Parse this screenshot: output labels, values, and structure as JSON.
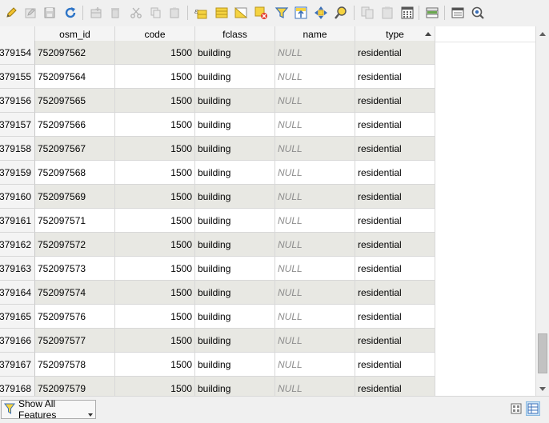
{
  "toolbar": {
    "icons": [
      "pencil-icon",
      "multi-edit-icon",
      "save-icon",
      "reload-icon",
      "add-feature-icon",
      "delete-icon",
      "cut-icon",
      "copy-icon",
      "paste-icon",
      "expression-select-icon",
      "select-all-icon",
      "invert-selection-icon",
      "deselect-icon",
      "filter-icon",
      "move-top-icon",
      "pan-icon",
      "zoom-icon",
      "copy-cells-icon",
      "paste-cells-icon",
      "field-calculator-icon",
      "conditional-format-icon",
      "form-view-icon",
      "actions-icon"
    ]
  },
  "table": {
    "columns": [
      {
        "key": "row_num",
        "label": ""
      },
      {
        "key": "osm_id",
        "label": "osm_id"
      },
      {
        "key": "code",
        "label": "code"
      },
      {
        "key": "fclass",
        "label": "fclass"
      },
      {
        "key": "name",
        "label": "name"
      },
      {
        "key": "type",
        "label": "type"
      }
    ],
    "rows": [
      {
        "row_num": "379154",
        "osm_id": "752097562",
        "code": "1500",
        "fclass": "building",
        "name": "NULL",
        "type": "residential"
      },
      {
        "row_num": "379155",
        "osm_id": "752097564",
        "code": "1500",
        "fclass": "building",
        "name": "NULL",
        "type": "residential"
      },
      {
        "row_num": "379156",
        "osm_id": "752097565",
        "code": "1500",
        "fclass": "building",
        "name": "NULL",
        "type": "residential"
      },
      {
        "row_num": "379157",
        "osm_id": "752097566",
        "code": "1500",
        "fclass": "building",
        "name": "NULL",
        "type": "residential"
      },
      {
        "row_num": "379158",
        "osm_id": "752097567",
        "code": "1500",
        "fclass": "building",
        "name": "NULL",
        "type": "residential"
      },
      {
        "row_num": "379159",
        "osm_id": "752097568",
        "code": "1500",
        "fclass": "building",
        "name": "NULL",
        "type": "residential"
      },
      {
        "row_num": "379160",
        "osm_id": "752097569",
        "code": "1500",
        "fclass": "building",
        "name": "NULL",
        "type": "residential"
      },
      {
        "row_num": "379161",
        "osm_id": "752097571",
        "code": "1500",
        "fclass": "building",
        "name": "NULL",
        "type": "residential"
      },
      {
        "row_num": "379162",
        "osm_id": "752097572",
        "code": "1500",
        "fclass": "building",
        "name": "NULL",
        "type": "residential"
      },
      {
        "row_num": "379163",
        "osm_id": "752097573",
        "code": "1500",
        "fclass": "building",
        "name": "NULL",
        "type": "residential"
      },
      {
        "row_num": "379164",
        "osm_id": "752097574",
        "code": "1500",
        "fclass": "building",
        "name": "NULL",
        "type": "residential"
      },
      {
        "row_num": "379165",
        "osm_id": "752097576",
        "code": "1500",
        "fclass": "building",
        "name": "NULL",
        "type": "residential"
      },
      {
        "row_num": "379166",
        "osm_id": "752097577",
        "code": "1500",
        "fclass": "building",
        "name": "NULL",
        "type": "residential"
      },
      {
        "row_num": "379167",
        "osm_id": "752097578",
        "code": "1500",
        "fclass": "building",
        "name": "NULL",
        "type": "residential"
      },
      {
        "row_num": "379168",
        "osm_id": "752097579",
        "code": "1500",
        "fclass": "building",
        "name": "NULL",
        "type": "residential"
      }
    ],
    "sorted_column": "type",
    "sort_order": "ascending"
  },
  "scrollbar": {
    "position_fraction": 0.97
  },
  "statusbar": {
    "filter_label": "Show All Features"
  },
  "colors": {
    "alt_row": "#e8e8e3",
    "null_text": "#8c8c8c",
    "accent": "#3a78c8"
  }
}
